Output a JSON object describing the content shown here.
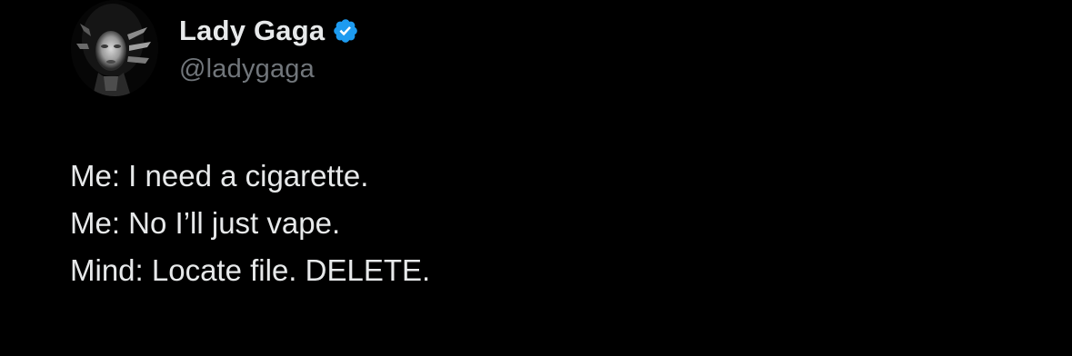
{
  "author": {
    "display_name": "Lady Gaga",
    "handle": "@ladygaga",
    "verified": true,
    "badge_color": "#1d9bf0",
    "avatar_icon": "profile-photo"
  },
  "tweet": {
    "lines": [
      "Me: I need a cigarette.",
      "Me: No I’ll just vape.",
      "Mind: Locate file. DELETE."
    ]
  },
  "colors": {
    "background": "#000000",
    "primary_text": "#e7e9ea",
    "secondary_text": "#71767b"
  }
}
